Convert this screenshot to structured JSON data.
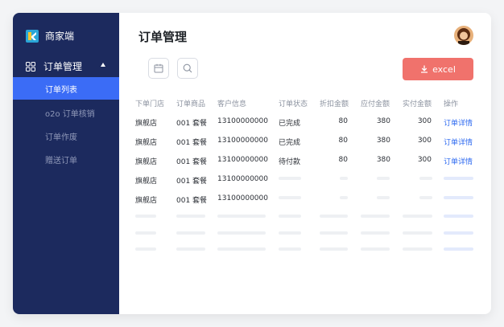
{
  "brand": {
    "name": "商家端"
  },
  "sidebar": {
    "group_label": "订单管理",
    "items": [
      {
        "label": "订单列表",
        "active": true
      },
      {
        "label": "o2o 订单核销",
        "active": false
      },
      {
        "label": "订单作废",
        "active": false
      },
      {
        "label": "赠送订单",
        "active": false
      }
    ]
  },
  "header": {
    "title": "订单管理"
  },
  "toolbar": {
    "calendar_icon": "calendar-icon",
    "search_icon": "search-icon",
    "export_label": "excel",
    "export_icon": "download-icon"
  },
  "table": {
    "columns": [
      "下单门店",
      "订单商品",
      "客户信息",
      "订单状态",
      "折扣金额",
      "应付金额",
      "实付金额",
      "操作"
    ],
    "rows": [
      {
        "store": "旗舰店",
        "product": "001 套餐",
        "customer": "13100000000",
        "status": "已完成",
        "discount": "80",
        "payable": "380",
        "paid": "300",
        "action": "订单详情"
      },
      {
        "store": "旗舰店",
        "product": "001 套餐",
        "customer": "13100000000",
        "status": "已完成",
        "discount": "80",
        "payable": "380",
        "paid": "300",
        "action": "订单详情"
      },
      {
        "store": "旗舰店",
        "product": "001 套餐",
        "customer": "13100000000",
        "status": "待付款",
        "discount": "80",
        "payable": "380",
        "paid": "300",
        "action": "订单详情"
      },
      {
        "store": "旗舰店",
        "product": "001 套餐",
        "customer": "13100000000"
      },
      {
        "store": "旗舰店",
        "product": "001 套餐",
        "customer": "13100000000"
      }
    ]
  },
  "colors": {
    "sidebar": "#1c2a5e",
    "active": "#3b6cf6",
    "export": "#f0726c",
    "link": "#2f6bf0"
  }
}
